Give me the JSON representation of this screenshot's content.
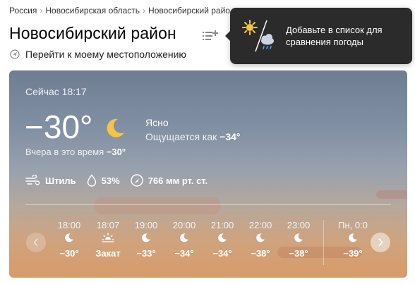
{
  "breadcrumb": {
    "items": [
      "Россия",
      "Новосибирская область",
      "Новосибирский райо"
    ],
    "separator": "›"
  },
  "title": "Новосибирский район",
  "location_link": "Перейти к моему местоположению",
  "tooltip": {
    "text": "Добавьте в список для сравнения погоды"
  },
  "current": {
    "now_label": "Сейчас 18:17",
    "temperature": "−30°",
    "condition": "Ясно",
    "feels_like_label": "Ощущается как ",
    "feels_like_value": "−34°",
    "yesterday_label": "Вчера в это время ",
    "yesterday_value": "−30°",
    "icon": "moon-icon"
  },
  "params": {
    "wind": "Штиль",
    "humidity": "53%",
    "pressure": "766 мм рт. ст."
  },
  "hourly": [
    {
      "time": "18:00",
      "icon": "moon-icon",
      "temp": "−30°"
    },
    {
      "time": "18:07",
      "icon": "sunset-icon",
      "temp": "Закат"
    },
    {
      "time": "19:00",
      "icon": "moon-icon",
      "temp": "−33°"
    },
    {
      "time": "20:00",
      "icon": "moon-icon",
      "temp": "−34°"
    },
    {
      "time": "21:00",
      "icon": "moon-icon",
      "temp": "−34°"
    },
    {
      "time": "22:00",
      "icon": "moon-icon",
      "temp": "−38°"
    },
    {
      "time": "23:00",
      "icon": "moon-icon",
      "temp": "−38°"
    },
    {
      "time": "Пн, 0:0",
      "icon": "moon-icon",
      "temp": "−39°"
    }
  ],
  "colors": {
    "card_top": "#6f7d93",
    "card_bottom": "#d89b69",
    "tooltip_bg": "#2b2b2b",
    "moon": "#f5c542"
  }
}
